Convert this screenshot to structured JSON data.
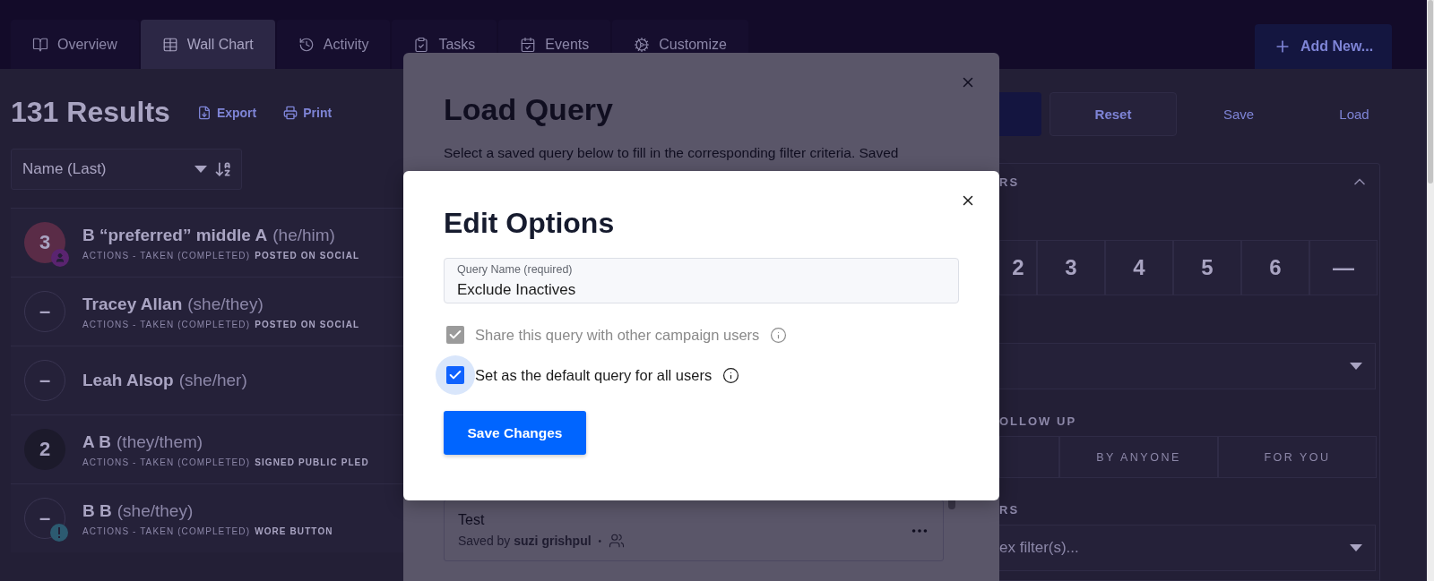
{
  "nav": {
    "tabs": [
      {
        "label": "Overview",
        "selected": false
      },
      {
        "label": "Wall Chart",
        "selected": true
      },
      {
        "label": "Activity",
        "selected": false
      },
      {
        "label": "Tasks",
        "selected": false
      },
      {
        "label": "Events",
        "selected": false
      },
      {
        "label": "Customize",
        "selected": false
      }
    ],
    "add_button": "Add New..."
  },
  "results": {
    "title": "131 Results",
    "export": "Export",
    "print": "Print",
    "sort": "Name (Last)"
  },
  "people": [
    {
      "name": "B “preferred” middle A",
      "pronouns": "(he/him)",
      "avatar": "3",
      "kind": "number",
      "color": "#5a2c47",
      "badge": {
        "kind": "user"
      },
      "label": "ACTIONS - TAKEN (COMPLETED)",
      "value": "POSTED ON SOCIAL"
    },
    {
      "name": "Tracey Allan",
      "pronouns": "(she/they)",
      "avatar": "–",
      "kind": "empty",
      "label": "ACTIONS - TAKEN (COMPLETED)",
      "value": "POSTED ON SOCIAL"
    },
    {
      "name": "Leah Alsop",
      "pronouns": "(she/her)",
      "avatar": "–",
      "kind": "empty"
    },
    {
      "name": "A B",
      "pronouns": "(they/them)",
      "avatar": "2",
      "kind": "number",
      "color": "#1c1a2b",
      "label": "ACTIONS - TAKEN (COMPLETED)",
      "value": "SIGNED PUBLIC PLED"
    },
    {
      "name": "B B",
      "pronouns": "(she/they)",
      "avatar": "–",
      "kind": "empty",
      "badge": {
        "kind": "alert"
      },
      "label": "ACTIONS - TAKEN (COMPLETED)",
      "value": "WORE BUTTON"
    }
  ],
  "filters": {
    "reset": "Reset",
    "save": "Save",
    "load": "Load",
    "section_title": "RS",
    "numbers": [
      "2",
      "3",
      "4",
      "5",
      "6",
      "—"
    ],
    "follow_label": "OLLOW UP",
    "follow_options": [
      "BY ANYONE",
      "FOR YOU"
    ],
    "filters_label": "RS",
    "filters_placeholder": "ex filter(s)..."
  },
  "load_query": {
    "title": "Load Query",
    "description": "Select a saved query below to fill in the corresponding filter criteria. Saved",
    "queries": [
      {
        "name": "Test",
        "saved_by": "Saved by **suzi grishpul**",
        "separator": "•",
        "shared": true
      }
    ]
  },
  "edit_options": {
    "title": "Edit Options",
    "field": {
      "label": "Query Name (required)",
      "value": "Exclude Inactives"
    },
    "options": [
      {
        "label": "Share this query with other campaign users",
        "checked": true,
        "disabled": true,
        "focused": false
      },
      {
        "label": "Set as the default query for all users",
        "checked": true,
        "disabled": false,
        "focused": true
      }
    ],
    "submit": "Save Changes"
  }
}
